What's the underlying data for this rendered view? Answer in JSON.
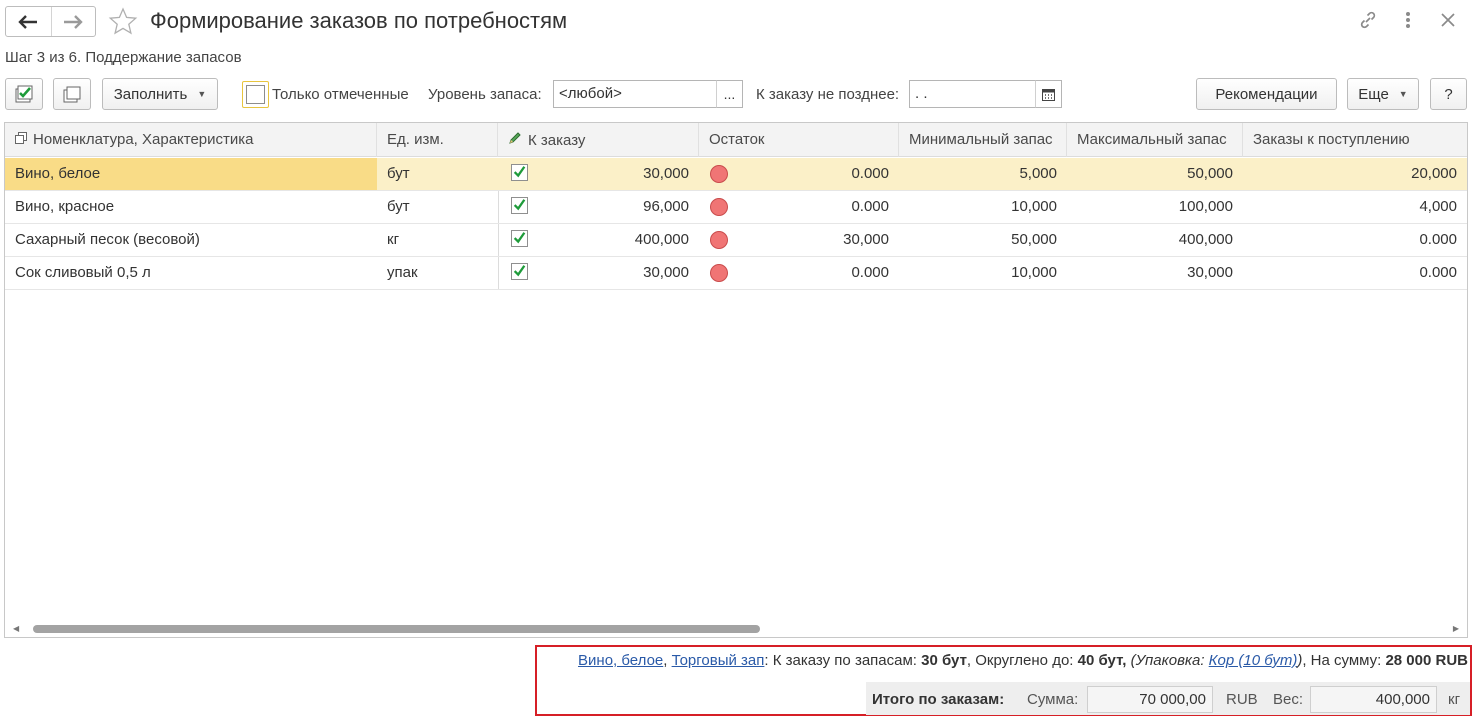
{
  "header": {
    "title": "Формирование заказов по потребностям",
    "back_icon": "arrow-left-icon",
    "forward_icon": "arrow-right-icon",
    "favorite_icon": "star-icon",
    "link_icon": "link-icon",
    "menu_icon": "more-vertical-icon",
    "close_icon": "close-icon"
  },
  "step": "Шаг 3 из 6. Поддержание запасов",
  "toolbar": {
    "fill_label": "Заполнить",
    "only_marked_label": "Только отмеченные",
    "only_marked_checked": false,
    "stock_level_label": "Уровень запаса:",
    "stock_level_value": "<любой>",
    "select_button": "...",
    "order_deadline_label": "К заказу не позднее:",
    "order_deadline_value": " .  .",
    "recommendations_label": "Рекомендации",
    "more_label": "Еще",
    "help_label": "?"
  },
  "table": {
    "columns": [
      "Номенклатура, Характеристика",
      "Ед. изм.",
      "К заказу",
      "Остаток",
      "Минимальный запас",
      "Максимальный запас",
      "Заказы к поступлению"
    ],
    "rows": [
      {
        "name": "Вино, белое",
        "unit": "бут",
        "checked": true,
        "to_order": "30,000",
        "status": "red",
        "stock": "0.000",
        "min": "5,000",
        "max": "50,000",
        "incoming": "20,000"
      },
      {
        "name": "Вино, красное",
        "unit": "бут",
        "checked": true,
        "to_order": "96,000",
        "status": "red",
        "stock": "0.000",
        "min": "10,000",
        "max": "100,000",
        "incoming": "4,000"
      },
      {
        "name": "Сахарный песок (весовой)",
        "unit": "кг",
        "checked": true,
        "to_order": "400,000",
        "status": "red",
        "stock": "30,000",
        "min": "50,000",
        "max": "400,000",
        "incoming": "0.000"
      },
      {
        "name": "Сок сливовый 0,5 л",
        "unit": "упак",
        "checked": true,
        "to_order": "30,000",
        "status": "red",
        "stock": "0.000",
        "min": "10,000",
        "max": "30,000",
        "incoming": "0.000"
      }
    ],
    "selected_row": 0
  },
  "footer": {
    "item_link": "Вино, белое",
    "sep1": ", ",
    "warehouse_link": "Торговый зап",
    "text1": ": К заказу по запасам: ",
    "qty": "30 бут",
    "text2": ", Округлено до: ",
    "rounded": "40 бут,",
    "pack_open": " (Упаковка: ",
    "pack_link": "Кор (10 бут)",
    "pack_close": ")",
    "text3": ", На сумму: ",
    "sum": "28 000 RUB",
    "totals_label": "Итого по заказам:",
    "sum_label": "Сумма:",
    "sum_value": "70 000,00",
    "currency": "RUB",
    "weight_label": "Вес:",
    "weight_value": "400,000",
    "weight_unit": "кг"
  },
  "colors": {
    "selected_row": "#fbf0c8",
    "selected_cell": "#f9dc87",
    "status_red": "#f07575",
    "check_green": "#1e9b3a",
    "highlight_border": "#d61f26",
    "link": "#2a5aa8"
  }
}
